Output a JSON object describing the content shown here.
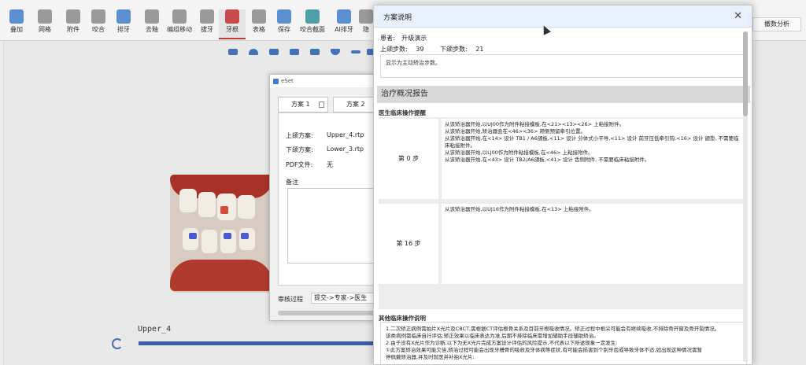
{
  "toolbar": {
    "buttons": [
      {
        "label": "叠加",
        "icon": "overlay-icon"
      },
      {
        "label": "网格",
        "icon": "grid-icon"
      },
      {
        "label": "附件",
        "icon": "attachment-icon"
      },
      {
        "label": "咬合",
        "icon": "occlusion-icon"
      },
      {
        "label": "排牙",
        "icon": "arrange-teeth-icon"
      },
      {
        "label": "去釉",
        "icon": "ipr-icon"
      },
      {
        "label": "编组移动",
        "icon": "group-move-icon"
      },
      {
        "label": "拔牙",
        "icon": "extraction-icon"
      },
      {
        "label": "牙根",
        "icon": "tooth-root-icon"
      },
      {
        "label": "表格",
        "icon": "table-icon"
      },
      {
        "label": "保存",
        "icon": "save-icon"
      },
      {
        "label": "咬合截面",
        "icon": "occlusion-section-icon"
      },
      {
        "label": "AI排牙",
        "icon": "ai-arrange-icon"
      },
      {
        "label": "隐",
        "icon": "hide-icon"
      }
    ],
    "right_tab": "撤数分析"
  },
  "viewer": {
    "upper_label": "Upper_4"
  },
  "eset": {
    "window_title": "eSet",
    "tabs": [
      "方案 1",
      "方案 2"
    ],
    "upper_label": "上颌方案:",
    "upper_value": "Upper_4.rtp",
    "lower_label": "下颌方案:",
    "lower_value": "Lower_3.rtp",
    "pdf_label": "PDF文件:",
    "pdf_value": "无",
    "notes_label": "备注",
    "review_label": "审核过程",
    "review_value": "提交->专家->医生"
  },
  "plan": {
    "title": "方案说明",
    "patient_label": "患者:",
    "patient_name": "升级演示",
    "upper_steps_label": "上颌步数:",
    "upper_steps": "39",
    "lower_steps_label": "下颌步数:",
    "lower_steps": "21",
    "message": "显示为主动矫治步数。",
    "report_title": "治疗概况报告",
    "ops_header": "医生临床操作提醒",
    "step_rows": [
      {
        "step": "第 0 步",
        "lines": [
          "从该矫治器开始,以UJ00作为附件粘接模板,在<21><13><26> 上粘接附件。",
          "从该矫治器开始,矫治器会在<46><36> 颊侧预留牵引位置。",
          "从该矫治器开始,在<14> 设计 TB1 / A6颌板,<11> 设计 分体式小平导,<11> 设计 前牙压低牵引钩,<16> 设计 颌垫, 不需要临床粘接附件。",
          "从该矫治器开始,以LJ00作为附件粘接模板,在<46> 上粘接附件。",
          "从该矫治器开始,在<43> 设计 TB2/A6颌板,<41> 设计 舌侧附件, 不需要临床粘接附件。"
        ]
      },
      {
        "step": "第 16 步",
        "lines": [
          "从该矫治器开始,以UJ16作为附件粘接模板,在<13> 上粘接附件。"
        ]
      }
    ],
    "other_header": "其他临床操作说明",
    "other_lines": [
      "1.二次矫正病例需拍片X光片及CBCT,需根据CT评估根骨关系及目前牙根吸收情况。矫正过程中根尖可能会有继续吸收,不排除骨开窗及骨开裂情况。",
      "该类病例需临床自行评估;矫正效果以临床表达为准,后期不排除临床需增加辅助手段辅助矫治。",
      "2.由于没有X光片作为诊断,以下为无X光片完成方案设计评估的风险提示,不代表以下所述现象一定发生:",
      "①此方案矫治效果可能欠佳,矫治过程可能会出现牙槽骨的吸收及牙体病等症状,有可能会损害到个别牙齿或导致牙体不适,如出现这种情况需暂",
      "停佩戴矫治器,并及时就医并补拍X光片;"
    ]
  }
}
